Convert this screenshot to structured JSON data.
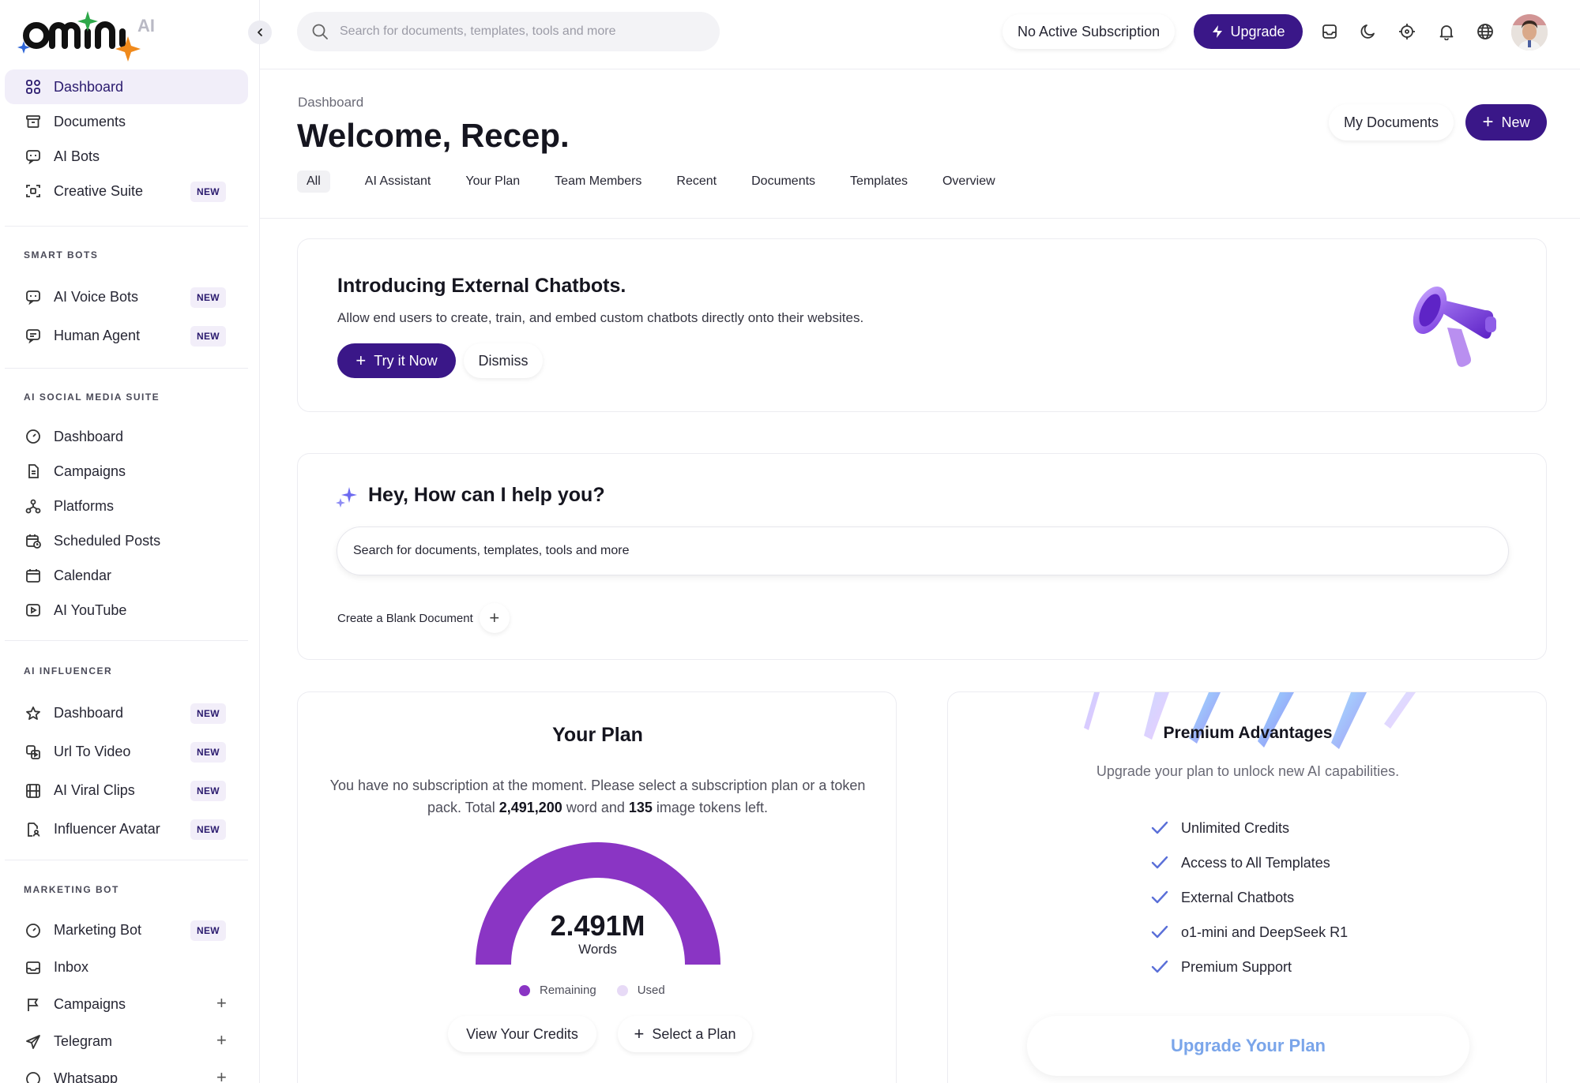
{
  "app": {
    "brand": "omini",
    "brand_suffix": "AI"
  },
  "topbar": {
    "search_placeholder": "Search for documents, templates, tools and more",
    "subscription_status": "No Active Subscription",
    "upgrade_label": "Upgrade"
  },
  "sidebar": {
    "main_items": [
      {
        "label": "Dashboard",
        "icon": "grid-icon",
        "active": true
      },
      {
        "label": "Documents",
        "icon": "archive-icon"
      },
      {
        "label": "AI Bots",
        "icon": "chat-bot-icon"
      },
      {
        "label": "Creative Suite",
        "icon": "frame-icon",
        "badge": "NEW"
      }
    ],
    "smart_bots": {
      "title": "SMART BOTS",
      "items": [
        {
          "label": "AI Voice Bots",
          "icon": "chat-bot-icon",
          "badge": "NEW"
        },
        {
          "label": "Human Agent",
          "icon": "message-icon",
          "badge": "NEW"
        }
      ]
    },
    "social_suite": {
      "title": "AI SOCIAL MEDIA SUITE",
      "items": [
        {
          "label": "Dashboard",
          "icon": "gauge-icon"
        },
        {
          "label": "Campaigns",
          "icon": "file-icon"
        },
        {
          "label": "Platforms",
          "icon": "network-icon"
        },
        {
          "label": "Scheduled Posts",
          "icon": "calendar-clock-icon"
        },
        {
          "label": "Calendar",
          "icon": "calendar-icon"
        },
        {
          "label": "AI YouTube",
          "icon": "play-icon"
        }
      ]
    },
    "influencer": {
      "title": "AI INFLUENCER",
      "items": [
        {
          "label": "Dashboard",
          "icon": "star-icon",
          "badge": "NEW"
        },
        {
          "label": "Url To Video",
          "icon": "link-video-icon",
          "badge": "NEW"
        },
        {
          "label": "AI Viral Clips",
          "icon": "film-icon",
          "badge": "NEW"
        },
        {
          "label": "Influencer Avatar",
          "icon": "avatar-file-icon",
          "badge": "NEW"
        }
      ]
    },
    "marketing": {
      "title": "MARKETING BOT",
      "items": [
        {
          "label": "Marketing Bot",
          "icon": "gauge-icon",
          "badge": "NEW"
        },
        {
          "label": "Inbox",
          "icon": "inbox-icon"
        },
        {
          "label": "Campaigns",
          "icon": "flag-icon",
          "plus": "+"
        },
        {
          "label": "Telegram",
          "icon": "send-icon",
          "plus": "+"
        },
        {
          "label": "Whatsapp",
          "icon": "whatsapp-icon",
          "plus": "+"
        }
      ]
    }
  },
  "header": {
    "breadcrumb": "Dashboard",
    "welcome": "Welcome, Recep.",
    "my_documents": "My Documents",
    "new_label": "New",
    "tabs": [
      "All",
      "AI Assistant",
      "Your Plan",
      "Team Members",
      "Recent",
      "Documents",
      "Templates",
      "Overview"
    ]
  },
  "promo": {
    "title": "Introducing External Chatbots.",
    "text": "Allow end users to create, train, and embed custom chatbots directly onto their websites.",
    "try_label": "Try it Now",
    "dismiss_label": "Dismiss"
  },
  "helper": {
    "title": "Hey, How can I help you?",
    "input_placeholder": "Search for documents, templates, tools and more",
    "blank_doc": "Create a Blank Document"
  },
  "plan": {
    "title": "Your Plan",
    "desc_part1": "You have no subscription at the moment. Please select a subscription plan or a token pack. Total ",
    "words": "2,491,200",
    "desc_part2": " word and ",
    "images": "135",
    "desc_part3": " image tokens left.",
    "gauge_value": "2.491M",
    "gauge_label": "Words",
    "remaining_fraction": 1.0,
    "legend_remaining": "Remaining",
    "legend_used": "Used",
    "view_credits": "View Your Credits",
    "select_plan": "Select a Plan",
    "colors": {
      "remaining": "#8a35c4",
      "used": "#e7daf6"
    }
  },
  "premium": {
    "title": "Premium Advantages",
    "subtitle": "Upgrade your plan to unlock new AI capabilities.",
    "features": [
      "Unlimited Credits",
      "Access to All Templates",
      "External Chatbots",
      "o1-mini and DeepSeek R1",
      "Premium Support"
    ],
    "cta": "Upgrade Your Plan"
  },
  "colors": {
    "accent": "#3a1788",
    "badge_bg": "#f2eef9",
    "active_bg": "#f1eef9"
  }
}
